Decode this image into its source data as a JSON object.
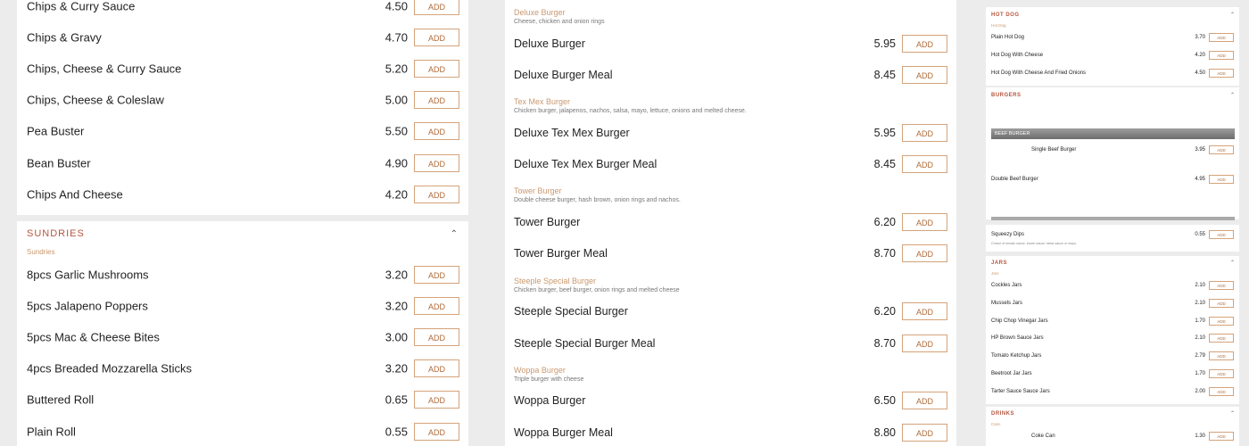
{
  "left": {
    "items_top": [
      {
        "name": "Chips & Curry Sauce",
        "price": "4.50"
      },
      {
        "name": "Chips & Gravy",
        "price": "4.70"
      },
      {
        "name": "Chips, Cheese & Curry Sauce",
        "price": "5.20"
      },
      {
        "name": "Chips, Cheese & Coleslaw",
        "price": "5.00"
      },
      {
        "name": "Pea Buster",
        "price": "5.50"
      },
      {
        "name": "Bean Buster",
        "price": "4.90"
      },
      {
        "name": "Chips And Cheese",
        "price": "4.20"
      }
    ],
    "sundries": {
      "heading": "SUNDRIES",
      "sub": "Sundries",
      "items": [
        {
          "name": "8pcs Garlic Mushrooms",
          "price": "3.20"
        },
        {
          "name": "5pcs Jalapeno Poppers",
          "price": "3.20"
        },
        {
          "name": "5pcs Mac & Cheese Bites",
          "price": "3.00"
        },
        {
          "name": "4pcs Breaded Mozzarella Sticks",
          "price": "3.20"
        },
        {
          "name": "Buttered Roll",
          "price": "0.65"
        },
        {
          "name": "Plain Roll",
          "price": "0.55"
        }
      ]
    }
  },
  "middle": {
    "groups": [
      {
        "title": "Deluxe Burger",
        "desc": "Cheese, chicken and onion rings",
        "items": [
          {
            "name": "Deluxe Burger",
            "price": "5.95"
          },
          {
            "name": "Deluxe Burger Meal",
            "price": "8.45"
          }
        ]
      },
      {
        "title": "Tex Mex Burger",
        "desc": "Chicken burger, jalapenos, nachos, salsa, mayo, lettuce, onions and melted cheese.",
        "items": [
          {
            "name": "Deluxe Tex Mex Burger",
            "price": "5.95"
          },
          {
            "name": "Deluxe Tex Mex Burger Meal",
            "price": "8.45"
          }
        ]
      },
      {
        "title": "Tower Burger",
        "desc": "Double cheese burger, hash brown, onion rings and nachos.",
        "items": [
          {
            "name": "Tower Burger",
            "price": "6.20"
          },
          {
            "name": "Tower Burger Meal",
            "price": "8.70"
          }
        ]
      },
      {
        "title": "Steeple Special Burger",
        "desc": "Chicken burger, beef burger, onion rings and melted cheese",
        "items": [
          {
            "name": "Steeple Special Burger",
            "price": "6.20"
          },
          {
            "name": "Steeple Special Burger Meal",
            "price": "8.70"
          }
        ]
      },
      {
        "title": "Woppa Burger",
        "desc": "Triple burger with cheese",
        "items": [
          {
            "name": "Woppa Burger",
            "price": "6.50"
          },
          {
            "name": "Woppa Burger Meal",
            "price": "8.80"
          }
        ]
      }
    ]
  },
  "right": {
    "hotdog": {
      "heading": "HOT DOG",
      "sub": "Hot Dog",
      "items": [
        {
          "name": "Plain Hot Dog",
          "price": "3.70"
        },
        {
          "name": "Hot Dog With Cheese",
          "price": "4.20"
        },
        {
          "name": "Hot Dog With Cheese And Fried Onions",
          "price": "4.50"
        }
      ]
    },
    "burgers": {
      "heading": "BURGERS",
      "beef_label": "BEEF BURGER",
      "single": {
        "name": "Single Beef Burger",
        "price": "3.95"
      },
      "double": {
        "name": "Double Beef Burger",
        "price": "4.95"
      }
    },
    "dips": {
      "name": "Squeezy Dips",
      "price": "0.55",
      "desc": "Choice of tomato sauce, brown sauce, tartar sauce or mayo."
    },
    "jars": {
      "heading": "JARS",
      "sub": "Jars",
      "items": [
        {
          "name": "Cockles Jars",
          "price": "2.10"
        },
        {
          "name": "Mussels Jars",
          "price": "2.10"
        },
        {
          "name": "Chip Chop Vinegar Jars",
          "price": "1.70"
        },
        {
          "name": "HP Brown Sauce Jars",
          "price": "2.10"
        },
        {
          "name": "Tomato Ketchup Jars",
          "price": "2.79"
        },
        {
          "name": "Beetroot Jar Jars",
          "price": "1.70"
        },
        {
          "name": "Tarter Sauce Sauce Jars",
          "price": "2.00"
        }
      ]
    },
    "drinks": {
      "heading": "DRINKS",
      "sub": "Cans",
      "items": [
        {
          "name": "Coke Can",
          "price": "1.30"
        }
      ]
    }
  },
  "add_label": "ADD",
  "chevron_up": "⌃",
  "colors": {
    "accent": "#b5563f",
    "button_border": "#d4a37a",
    "subtle": "#c9996f"
  }
}
